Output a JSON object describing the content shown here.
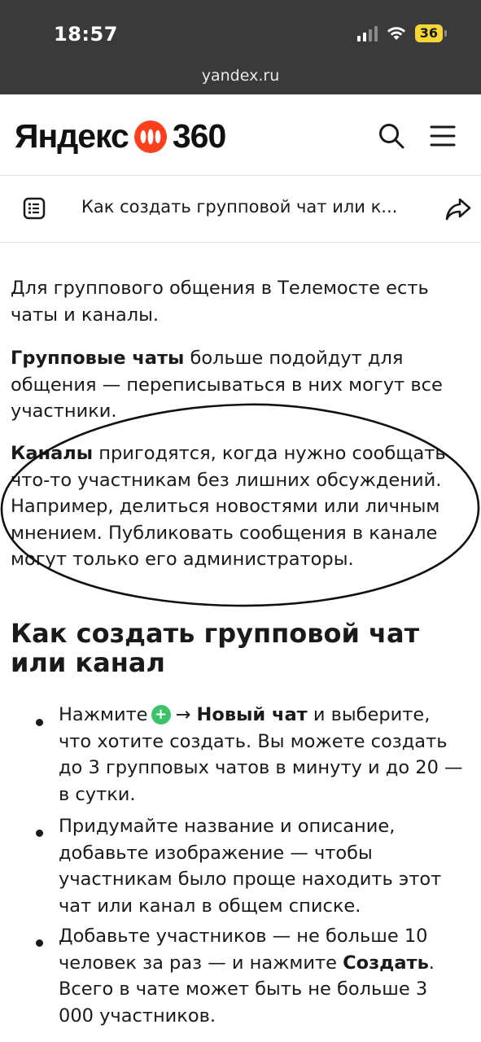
{
  "status_bar": {
    "time": "18:57",
    "battery": "36",
    "icons": [
      "signal-icon",
      "wifi-icon",
      "battery-icon"
    ]
  },
  "browser": {
    "url": "yandex.ru"
  },
  "header": {
    "logo_left": "Яндекс",
    "logo_right": "360",
    "icons": [
      "search-icon",
      "menu-icon"
    ],
    "brand_color": "#fc3f1d"
  },
  "article_nav": {
    "title": "Как создать групповой чат или к...",
    "icons": [
      "toc-icon",
      "share-icon"
    ]
  },
  "content": {
    "intro": "Для группового общения в Телемосте есть чаты и каналы.",
    "group_chats_bold": "Групповые чаты",
    "group_chats_text": " больше подойдут для общения  — переписываться в них могут все участники.",
    "channels_bold": "Каналы",
    "channels_text": " пригодятся, когда нужно сообщать что-то участникам без лишних обсуждений. Например, делиться новостями или личным мнением. Публиковать сообщения в канале могут только его администраторы.",
    "heading": "Как создать групповой чат или канал",
    "steps": [
      {
        "pre": "Нажмите",
        "icon_label": "+",
        "arrow": "→",
        "bold": "Новый чат",
        "text": " и выберите, что хотите создать. Вы можете создать до 3 групповых чатов в минуту и до 20 — в сутки."
      },
      {
        "text": "Придумайте название и описание, добавьте изображение — чтобы участникам было проще находить этот чат или канал в общем списке."
      },
      {
        "pre": "Добавьте участников — не больше 10 человек за раз — и нажмите ",
        "bold": "Создать",
        "text": ". Всего в чате может быть не больше 3 000 участников."
      }
    ],
    "accent_green": "#3bc36a"
  }
}
